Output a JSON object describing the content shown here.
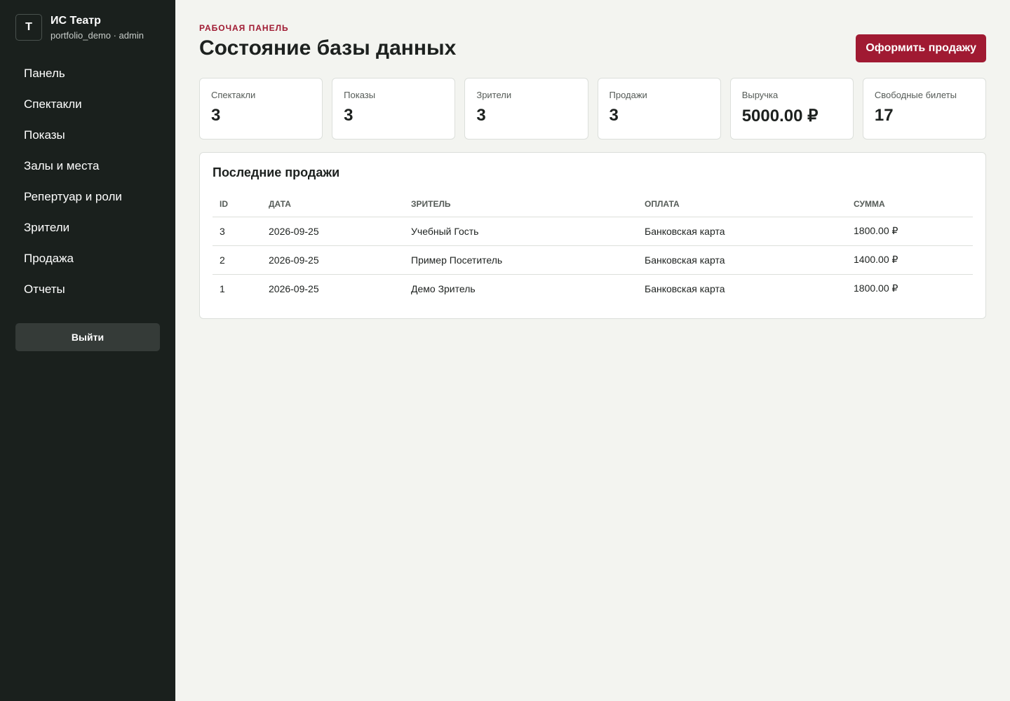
{
  "brand": {
    "logo_letter": "Т",
    "title": "ИС Театр",
    "subtitle": "portfolio_demo · admin"
  },
  "sidebar": {
    "items": [
      {
        "label": "Панель"
      },
      {
        "label": "Спектакли"
      },
      {
        "label": "Показы"
      },
      {
        "label": "Залы и места"
      },
      {
        "label": "Репертуар и роли"
      },
      {
        "label": "Зрители"
      },
      {
        "label": "Продажа"
      },
      {
        "label": "Отчеты"
      }
    ],
    "logout_label": "Выйти"
  },
  "header": {
    "eyebrow": "РАБОЧАЯ ПАНЕЛЬ",
    "title": "Состояние базы данных",
    "action_label": "Оформить продажу"
  },
  "stats": [
    {
      "label": "Спектакли",
      "value": "3"
    },
    {
      "label": "Показы",
      "value": "3"
    },
    {
      "label": "Зрители",
      "value": "3"
    },
    {
      "label": "Продажи",
      "value": "3"
    },
    {
      "label": "Выручка",
      "value": "5000.00 ₽"
    },
    {
      "label": "Свободные билеты",
      "value": "17"
    }
  ],
  "recent_sales": {
    "title": "Последние продажи",
    "columns": [
      "ID",
      "ДАТА",
      "ЗРИТЕЛЬ",
      "ОПЛАТА",
      "СУММА"
    ],
    "rows": [
      [
        "3",
        "2026-09-25",
        "Учебный Гость",
        "Банковская карта",
        "1800.00 ₽"
      ],
      [
        "2",
        "2026-09-25",
        "Пример Посетитель",
        "Банковская карта",
        "1400.00 ₽"
      ],
      [
        "1",
        "2026-09-25",
        "Демо Зритель",
        "Банковская карта",
        "1800.00 ₽"
      ]
    ]
  },
  "colors": {
    "accent": "#a01a32",
    "sidebar_bg": "#1a201d",
    "page_bg": "#f3f4f0"
  }
}
